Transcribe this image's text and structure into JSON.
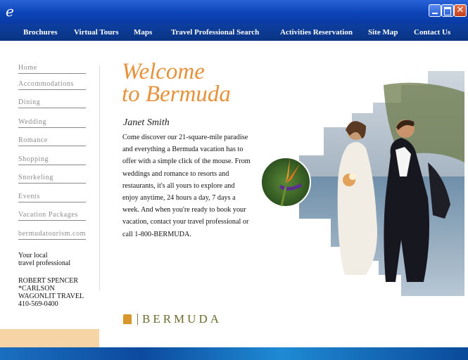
{
  "window": {
    "app_icon": "ie-icon"
  },
  "nav": {
    "items": [
      "Brochures",
      "Virtual Tours",
      "Maps",
      "Travel Professional Search",
      "Activities Reservation",
      "Site Map",
      "Contact Us"
    ]
  },
  "sidebar": {
    "links": [
      "Home",
      "Accommodations",
      "Dining",
      "Wedding",
      "Romance",
      "Shopping",
      "Snorkeling",
      "Events",
      "Vacation Packages",
      "bermudatourism.com"
    ],
    "local_label_line1": "Your local",
    "local_label_line2": "travel professional",
    "agent": [
      "ROBERT SPENCER",
      "*CARLSON",
      "WAGONLIT TRAVEL",
      "410-569-0400"
    ]
  },
  "main": {
    "headline_line1": "Welcome",
    "headline_line2": "to Bermuda",
    "author": "Janet Smith",
    "body": "Come discover our 21-square-mile paradise and everything a Bermuda vacation has to offer with a simple click of the mouse. From weddings and romance to resorts and restaurants, it's all yours to explore and enjoy anytime, 24 hours a day, 7 days a week. And when you're ready to book your vacation, contact your travel professional or call 1-800-BERMUDA.",
    "logo_text": "BERMUDA"
  },
  "colors": {
    "accent": "#e8913a",
    "nav": "#0c3f9f",
    "peach": "#f7d4a6"
  }
}
